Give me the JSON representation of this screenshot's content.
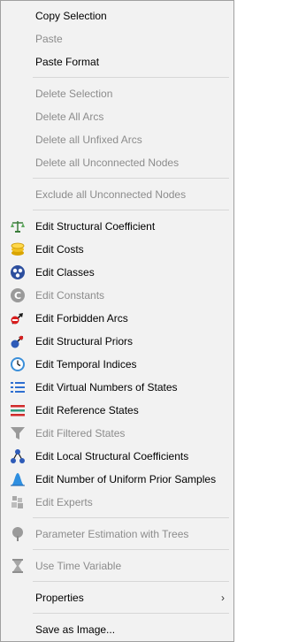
{
  "menu": {
    "items": [
      {
        "label": "Copy Selection"
      },
      {
        "label": "Paste"
      },
      {
        "label": "Paste Format"
      },
      {
        "label": "Delete Selection"
      },
      {
        "label": "Delete All Arcs"
      },
      {
        "label": "Delete all Unfixed Arcs"
      },
      {
        "label": "Delete all Unconnected Nodes"
      },
      {
        "label": "Exclude all Unconnected Nodes"
      },
      {
        "label": "Edit Structural Coefficient"
      },
      {
        "label": "Edit Costs"
      },
      {
        "label": "Edit Classes"
      },
      {
        "label": "Edit Constants"
      },
      {
        "label": "Edit Forbidden Arcs"
      },
      {
        "label": "Edit Structural Priors"
      },
      {
        "label": "Edit Temporal Indices"
      },
      {
        "label": "Edit Virtual Numbers of States"
      },
      {
        "label": "Edit Reference States"
      },
      {
        "label": "Edit Filtered States"
      },
      {
        "label": "Edit Local Structural Coefficients"
      },
      {
        "label": "Edit Number of Uniform Prior Samples"
      },
      {
        "label": "Edit Experts"
      },
      {
        "label": "Parameter Estimation with Trees"
      },
      {
        "label": "Use Time Variable"
      },
      {
        "label": "Properties"
      },
      {
        "label": "Save as Image..."
      }
    ]
  }
}
